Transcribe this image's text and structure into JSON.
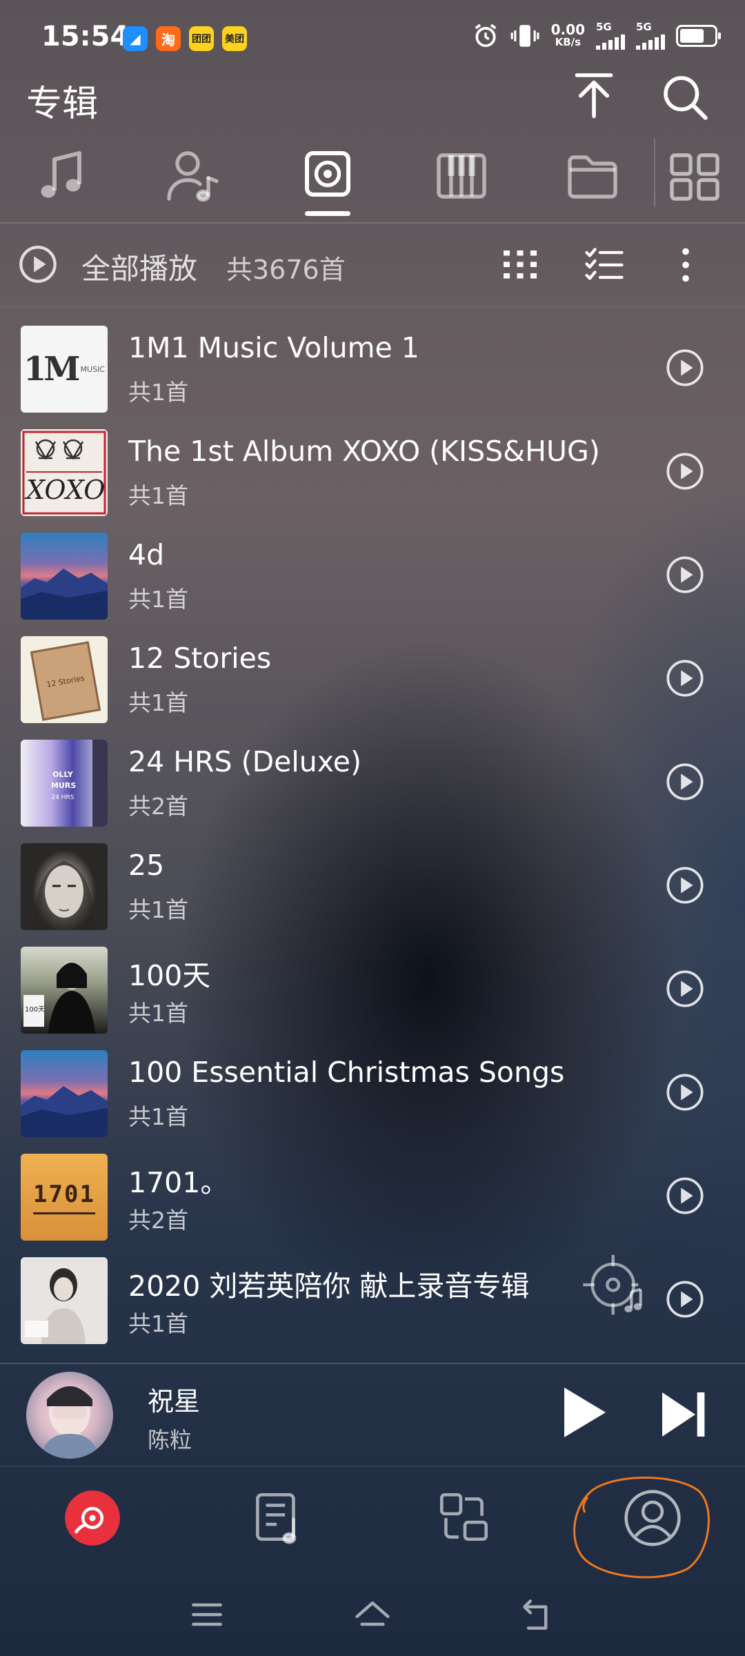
{
  "status_bar": {
    "time": "15:54",
    "apps": [
      {
        "name": "taobao",
        "text": "淘",
        "color": "#ff6a1a"
      },
      {
        "name": "meituan-1",
        "text": "团团",
        "color": "#ffd21f"
      },
      {
        "name": "meituan",
        "text": "美团",
        "color": "#ffd21f"
      }
    ],
    "network_speed": "0.00",
    "network_unit": "KB/s",
    "sim1": "5G",
    "sim2": "5G"
  },
  "header": {
    "title": "专辑"
  },
  "tabs": [
    {
      "name": "songs",
      "icon": "music-note-icon",
      "active": false
    },
    {
      "name": "artists",
      "icon": "artist-icon",
      "active": false
    },
    {
      "name": "albums",
      "icon": "album-icon",
      "active": true
    },
    {
      "name": "piano",
      "icon": "piano-icon",
      "active": false
    },
    {
      "name": "folders",
      "icon": "folder-icon",
      "active": false
    },
    {
      "name": "grid",
      "icon": "grid-icon",
      "active": false
    }
  ],
  "play_all": {
    "label": "全部播放",
    "total": "共3676首"
  },
  "albums": [
    {
      "title": "1M1 Music Volume 1",
      "count": "共1首",
      "cover_text": "1M",
      "cover_sub": "MUSIC"
    },
    {
      "title": "The 1st Album XOXO (KISS&HUG)",
      "count": "共1首",
      "cover_text": "XOXO",
      "cover_sub": ""
    },
    {
      "title": "4d",
      "count": "共1首",
      "cover_text": "",
      "cover_sub": ""
    },
    {
      "title": "12 Stories",
      "count": "共1首",
      "cover_text": "12 Stories",
      "cover_sub": ""
    },
    {
      "title": "24 HRS (Deluxe)",
      "count": "共2首",
      "cover_text": "OLLY MURS",
      "cover_sub": "24 HRS"
    },
    {
      "title": "25",
      "count": "共1首",
      "cover_text": "",
      "cover_sub": ""
    },
    {
      "title": "100天",
      "count": "共1首",
      "cover_text": "100天",
      "cover_sub": ""
    },
    {
      "title": "100 Essential Christmas Songs",
      "count": "共1首",
      "cover_text": "",
      "cover_sub": ""
    },
    {
      "title": "1701。",
      "count": "共2首",
      "cover_text": "1701",
      "cover_sub": ""
    },
    {
      "title": "2020 刘若英陪你 献上录音专辑",
      "count": "共1首",
      "cover_text": "",
      "cover_sub": ""
    }
  ],
  "now_playing": {
    "title": "祝星",
    "artist": "陈粒"
  },
  "bottom_nav": [
    {
      "name": "music",
      "icon": "vinyl-icon",
      "active": true
    },
    {
      "name": "playlist",
      "icon": "playlist-icon",
      "active": false
    },
    {
      "name": "discover",
      "icon": "shapes-icon",
      "active": false
    },
    {
      "name": "profile",
      "icon": "profile-icon",
      "active": false
    }
  ],
  "colors": {
    "accent": "#e8313c",
    "annotation": "#f0781e"
  }
}
